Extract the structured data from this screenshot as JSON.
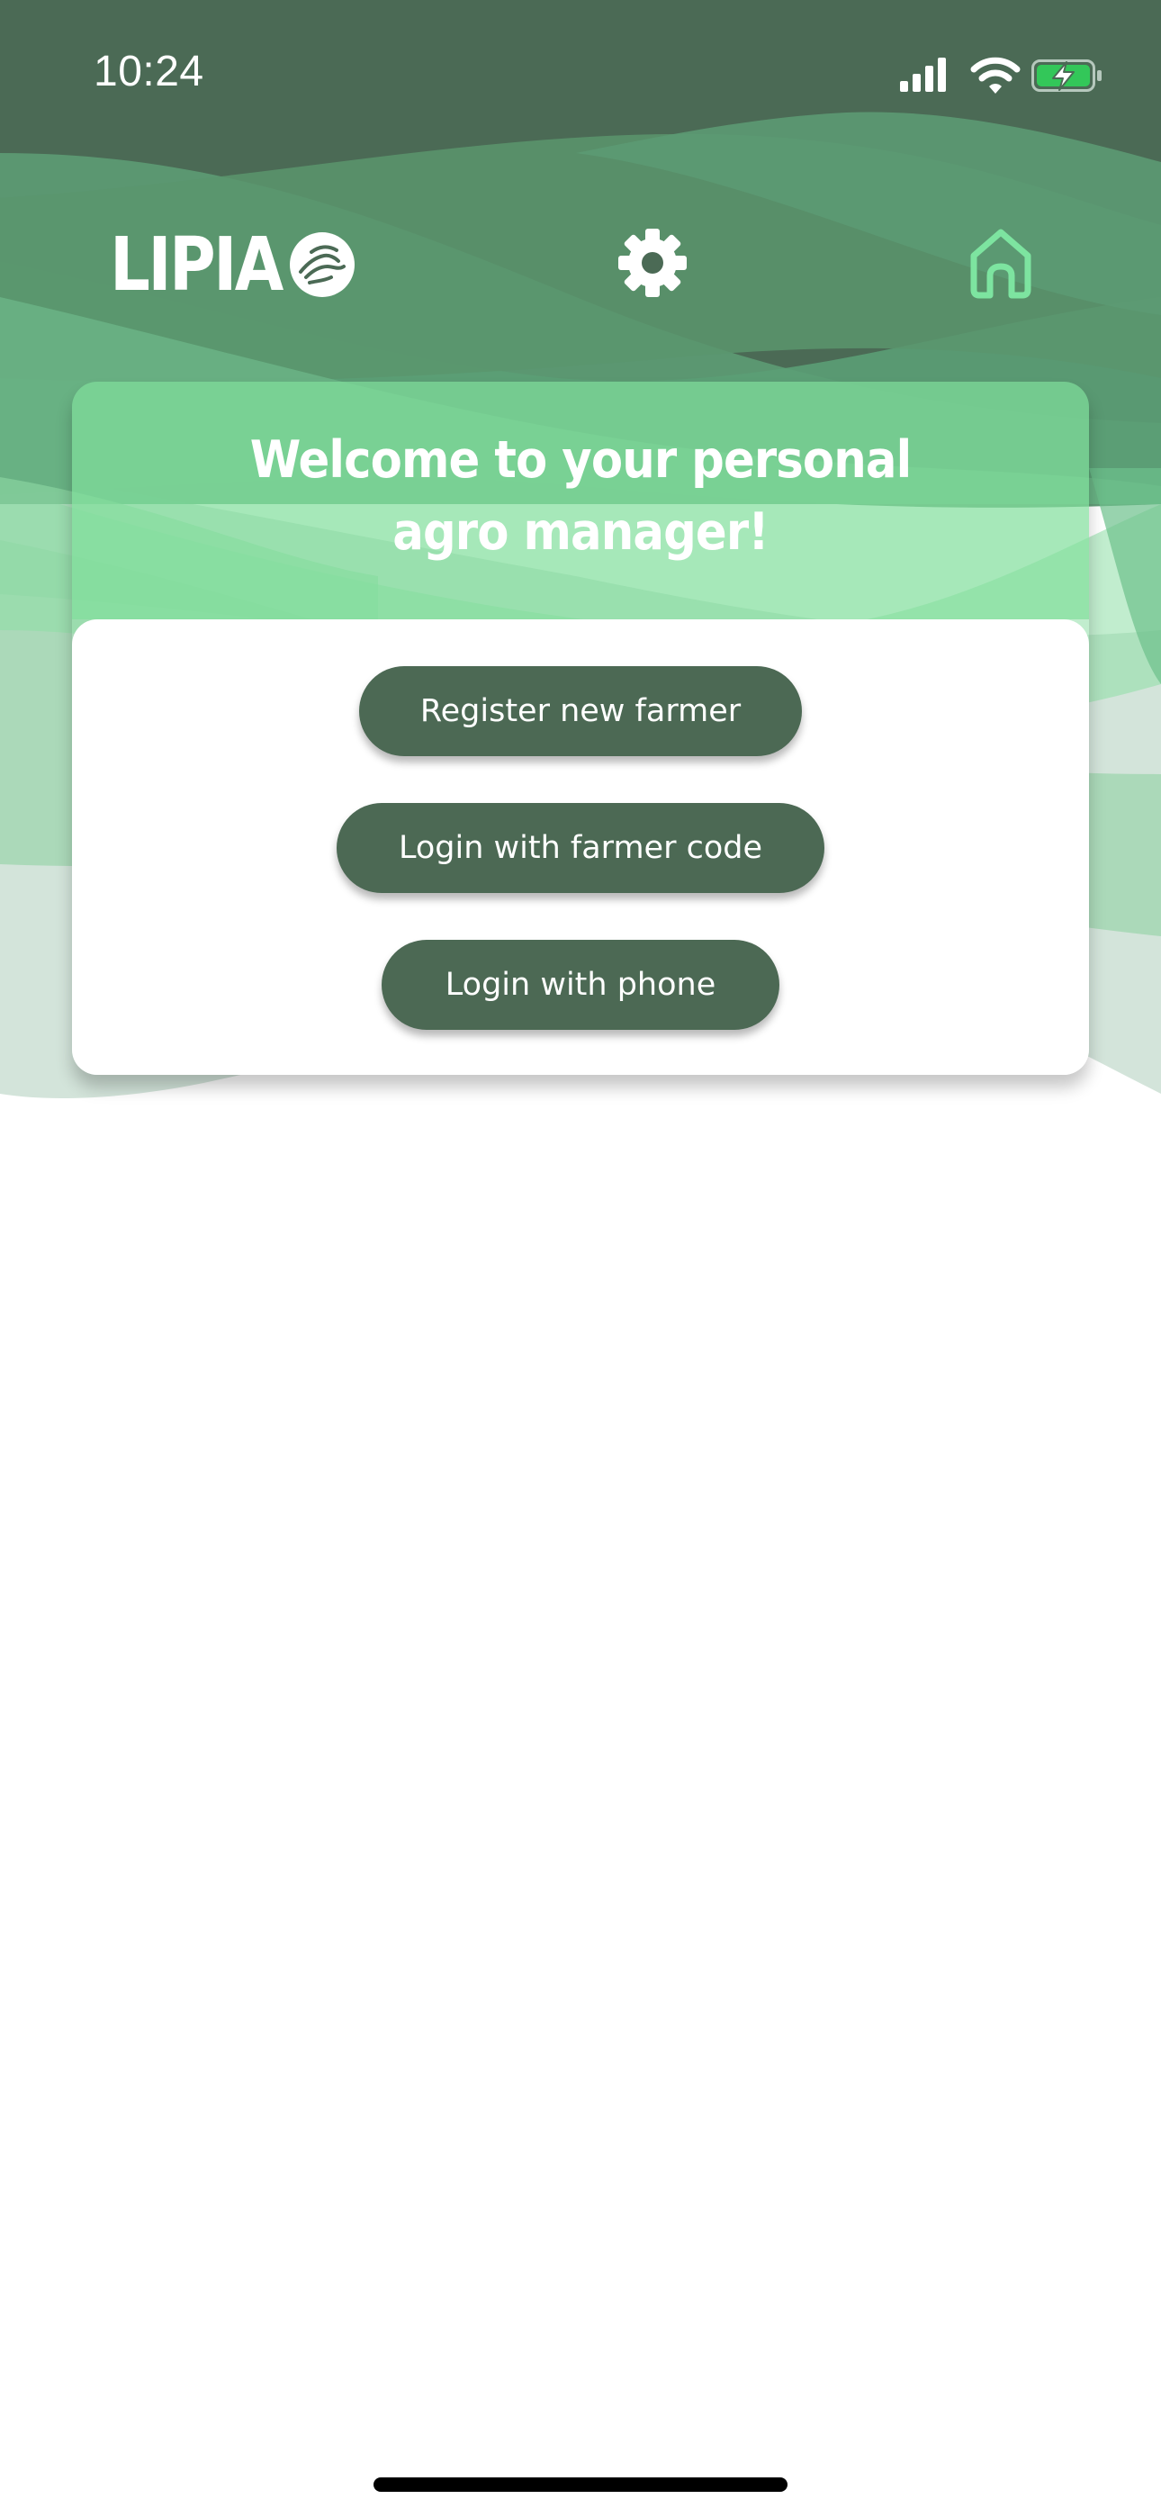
{
  "status_bar": {
    "time": "10:24",
    "icons": [
      "cellular-signal-icon",
      "wifi-icon",
      "battery-charging-icon"
    ]
  },
  "header": {
    "logo_text": "LIPIA",
    "logo_mark_icon": "handshake-circle-icon",
    "settings_icon": "gear-icon",
    "home_icon": "home-icon"
  },
  "welcome": {
    "title": "Welcome to your personal agro manager!",
    "buttons": {
      "register": "Register new farmer",
      "farmer_code": "Login with farmer code",
      "phone": "Login with phone"
    }
  },
  "colors": {
    "primary_dark_green": "#4c6954",
    "header_green": "#5a9672",
    "accent_light_green": "#80de9b",
    "home_icon_green": "#7de4a0",
    "battery_green": "#33c759",
    "background": "#ffffff"
  }
}
